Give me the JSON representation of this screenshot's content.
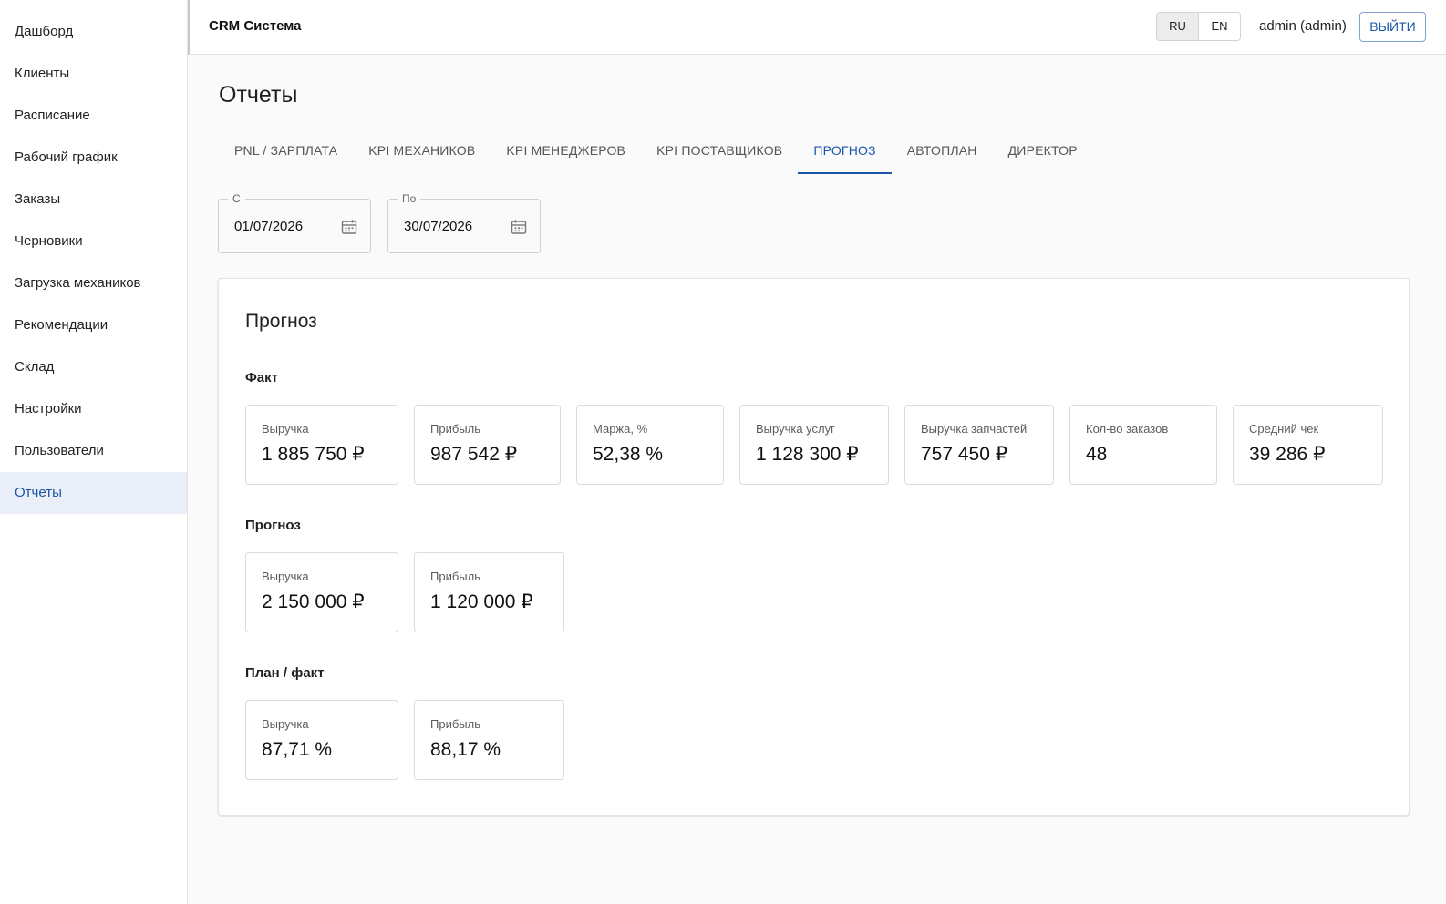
{
  "sidebar": {
    "items": [
      {
        "label": "Дашборд"
      },
      {
        "label": "Клиенты"
      },
      {
        "label": "Расписание"
      },
      {
        "label": "Рабочий график"
      },
      {
        "label": "Заказы"
      },
      {
        "label": "Черновики"
      },
      {
        "label": "Загрузка механиков"
      },
      {
        "label": "Рекомендации"
      },
      {
        "label": "Склад"
      },
      {
        "label": "Настройки"
      },
      {
        "label": "Пользователи"
      },
      {
        "label": "Отчеты"
      }
    ],
    "active_index": 11
  },
  "header": {
    "brand": "CRM Система",
    "lang_ru": "RU",
    "lang_en": "EN",
    "active_lang": "RU",
    "user": "admin (admin)",
    "logout_label": "ВЫЙТИ"
  },
  "page": {
    "title": "Отчеты",
    "tabs": [
      {
        "label": "PNL / ЗАРПЛАТА"
      },
      {
        "label": "KPI МЕХАНИКОВ"
      },
      {
        "label": "KPI МЕНЕДЖЕРОВ"
      },
      {
        "label": "KPI ПОСТАВЩИКОВ"
      },
      {
        "label": "ПРОГНОЗ"
      },
      {
        "label": "АВТОПЛАН"
      },
      {
        "label": "ДИРЕКТОР"
      }
    ],
    "active_tab_index": 4
  },
  "filters": {
    "from": {
      "label": "С",
      "value": "01/07/2026"
    },
    "to": {
      "label": "По",
      "value": "30/07/2026"
    }
  },
  "forecast": {
    "title": "Прогноз",
    "fact": {
      "title": "Факт",
      "cards": [
        {
          "label": "Выручка",
          "value": "1 885 750 ₽"
        },
        {
          "label": "Прибыль",
          "value": "987 542 ₽"
        },
        {
          "label": "Маржа, %",
          "value": "52,38 %"
        },
        {
          "label": "Выручка услуг",
          "value": "1 128 300 ₽"
        },
        {
          "label": "Выручка запчастей",
          "value": "757 450 ₽"
        },
        {
          "label": "Кол-во заказов",
          "value": "48"
        },
        {
          "label": "Средний чек",
          "value": "39 286 ₽"
        }
      ]
    },
    "forecast": {
      "title": "Прогноз",
      "cards": [
        {
          "label": "Выручка",
          "value": "2 150 000 ₽"
        },
        {
          "label": "Прибыль",
          "value": "1 120 000 ₽"
        }
      ]
    },
    "plan_fact": {
      "title": "План / факт",
      "cards": [
        {
          "label": "Выручка",
          "value": "87,71 %"
        },
        {
          "label": "Прибыль",
          "value": "88,17 %"
        }
      ]
    }
  },
  "colors": {
    "accent": "#1a56a8",
    "active_nav_bg": "#e9eef7"
  }
}
